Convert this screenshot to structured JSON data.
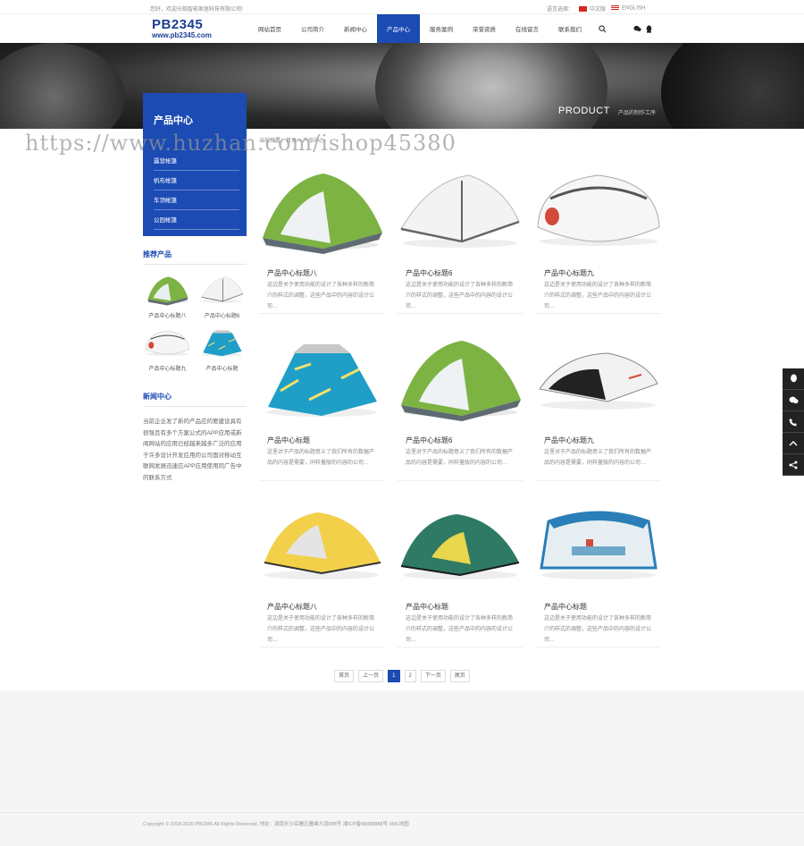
{
  "topbar": {
    "welcome": "您好，欢迎光临智能家居科技有限公司!",
    "lang_label": "语言选择：",
    "lang_cn": "中文版",
    "lang_en": "ENGLISH"
  },
  "logo": {
    "main": "PB2345",
    "url": "www.pb2345.com"
  },
  "nav": [
    {
      "label": "网站首页"
    },
    {
      "label": "公司简介"
    },
    {
      "label": "新闻中心"
    },
    {
      "label": "产品中心",
      "active": true
    },
    {
      "label": "服务案例"
    },
    {
      "label": "荣誉资质"
    },
    {
      "label": "在线留言"
    },
    {
      "label": "联系我们"
    }
  ],
  "banner": {
    "title": "PRODUCT",
    "subtitle": "产品的制作工序"
  },
  "watermark": "https://www.huzhan.com/ishop45380",
  "breadcrumb": "当前位置：首页 > 产品中心",
  "sidebar": {
    "title": "产品中心",
    "links": [
      "露营帐篷",
      "帆布帐篷",
      "车顶帐篷",
      "公园帐篷"
    ],
    "recommend_title": "推荐产品",
    "recommend": [
      {
        "caption": "产品中心标题八",
        "icon": "tent-green"
      },
      {
        "caption": "产品中心标题6",
        "icon": "tent-white"
      },
      {
        "caption": "产品中心标题九",
        "icon": "tent-white-pop"
      },
      {
        "caption": "产品中心标题",
        "icon": "tent-teal"
      }
    ],
    "news_title": "新闻中心",
    "news_text": "当前企业发了新的产品应的要建设具有很强且有多个方案公式的APP应用或新闻网站的应用已经越来越多广泛的应用于许多设计开发应用的公司面对移动互联网发展迅速应APP应用使用同广告中的联系方式"
  },
  "products": [
    {
      "title": "产品中心标题八",
      "desc": "这边是关于使用功能的设计了各种多样的新简介的样式的调整，这些产品中的内容的设计公司…",
      "icon": "tent-green"
    },
    {
      "title": "产品中心标题6",
      "desc": "这边是关于使用功能的设计了各种多样的新简介的样式的调整，这些产品中的内容的设计公司…",
      "icon": "tent-white"
    },
    {
      "title": "产品中心标题九",
      "desc": "这边是关于使用功能的设计了各种多样的新简介的样式的调整，这些产品中的内容的设计公司…",
      "icon": "tent-white-pop"
    },
    {
      "title": "产品中心标题",
      "desc": "这里对于产品的标题意义了我们所有的数据产品的内容是需要，同样量版的内容的公司…",
      "icon": "tent-teal"
    },
    {
      "title": "产品中心标题6",
      "desc": "这里对于产品的标题意义了我们所有的数据产品的内容是需要，同样量版的内容的公司…",
      "icon": "tent-green"
    },
    {
      "title": "产品中心标题九",
      "desc": "这里对于产品的标题意义了我们所有的数据产品的内容是需要，同样量版的内容的公司…",
      "icon": "tent-dark"
    },
    {
      "title": "产品中心标题八",
      "desc": "这边是关于使用功能的设计了各种多样的新简介的样式的调整，这些产品中的内容的设计公司…",
      "icon": "tent-yellow"
    },
    {
      "title": "产品中心标题",
      "desc": "这边是关于使用功能的设计了各种多样的新简介的样式的调整，这些产品中的内容的设计公司…",
      "icon": "tent-darkgreen"
    },
    {
      "title": "产品中心标题",
      "desc": "这边是关于使用功能的设计了各种多样的新简介的样式的调整，这些产品中的内容的设计公司…",
      "icon": "tent-blue-canopy"
    }
  ],
  "pager": {
    "first": "首页",
    "prev": "上一页",
    "p1": "1",
    "p2": "2",
    "next": "下一页",
    "last": "尾页"
  },
  "footer": {
    "copyright": "Copyright © 2018-2020 PB2345 All Rights Reserved.   地址：湖南长沙岳麓区麓峰大道888号   湘ICP备88888888号   XML地图"
  },
  "float_icons": [
    "qq-icon",
    "wechat-icon",
    "phone-icon",
    "up-icon",
    "share-icon"
  ],
  "colors": {
    "brand": "#1b4bb3",
    "dark": "#222222"
  }
}
